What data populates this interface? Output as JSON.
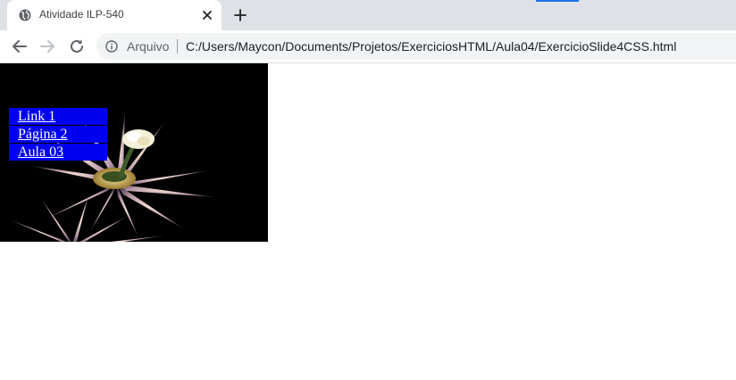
{
  "tab": {
    "title": "Atividade ILP-540",
    "favicon": "globe-icon",
    "close_icon": "close-icon"
  },
  "new_tab_icon": "plus-icon",
  "toolbar": {
    "back_icon": "back-arrow-icon",
    "forward_icon": "forward-arrow-icon",
    "reload_icon": "reload-icon",
    "info_icon": "info-icon",
    "scheme_label": "Arquivo",
    "url": "C:/Users/Maycon/Documents/Projetos/ExerciciosHTML/Aula04/ExercicioSlide4CSS.html"
  },
  "page": {
    "menu": [
      {
        "label": "Link 1"
      },
      {
        "label": "Página 2"
      },
      {
        "label": "Aula 03"
      }
    ]
  },
  "colors": {
    "tabstrip": "#dee1e6",
    "link_background": "#0000ee",
    "link_text": "#ffffff",
    "image_background": "#000000"
  }
}
